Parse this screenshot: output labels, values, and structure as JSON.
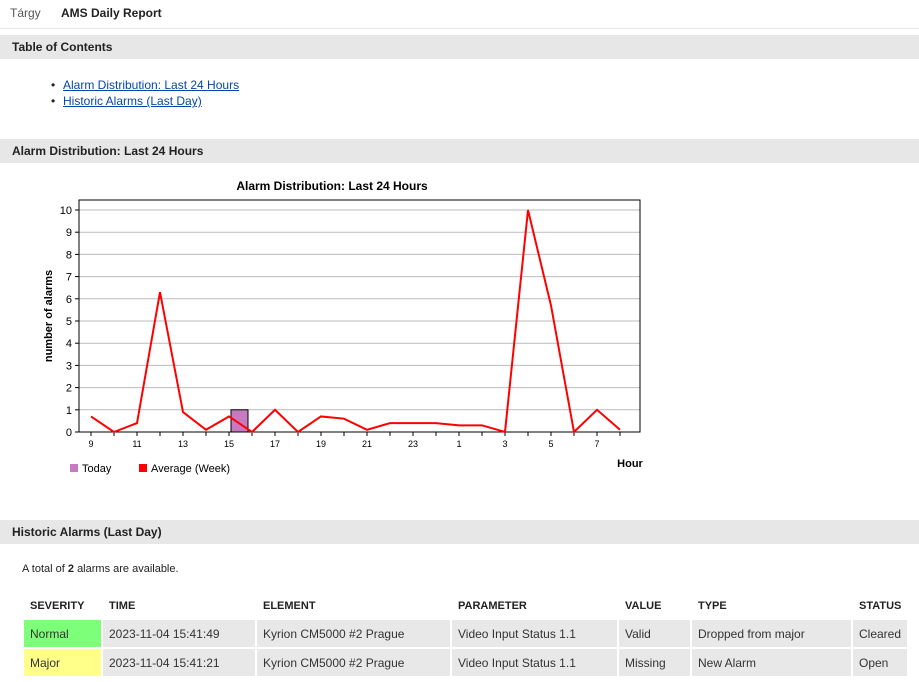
{
  "subject": {
    "label": "Tárgy",
    "value": "AMS Daily Report"
  },
  "toc": {
    "title": "Table of Contents",
    "items": [
      "Alarm Distribution: Last 24 Hours",
      "Historic Alarms (Last Day)"
    ]
  },
  "alarm_section": {
    "title": "Alarm Distribution: Last 24 Hours"
  },
  "chart_data": {
    "type": "line",
    "title": "Alarm Distribution: Last 24 Hours",
    "ylabel": "number of alarms",
    "xlabel": "Hour",
    "ylim": [
      0,
      10
    ],
    "yticks": [
      0,
      1,
      2,
      3,
      4,
      5,
      6,
      7,
      8,
      9,
      10
    ],
    "x": [
      "9",
      "10",
      "11",
      "12",
      "13",
      "14",
      "15",
      "16",
      "17",
      "18",
      "19",
      "20",
      "21",
      "22",
      "23",
      "0",
      "1",
      "2",
      "3",
      "4",
      "5",
      "6",
      "7",
      "8"
    ],
    "xtick_labels": [
      "9",
      "11",
      "13",
      "15",
      "17",
      "19",
      "21",
      "23",
      "1",
      "3",
      "5",
      "7"
    ],
    "series": [
      {
        "name": "Today",
        "type": "bar",
        "color": "#c87ac0",
        "values": [
          0,
          0,
          0,
          0,
          0,
          0,
          1,
          0,
          0,
          0,
          0,
          0,
          0,
          0,
          0,
          0,
          0,
          0,
          0,
          0,
          0,
          0,
          0,
          0
        ]
      },
      {
        "name": "Average (Week)",
        "type": "line",
        "color": "#ff0000",
        "values": [
          0.7,
          0,
          0.4,
          6.3,
          0.9,
          0.1,
          0.7,
          0,
          1.0,
          0,
          0.7,
          0.6,
          0.1,
          0.4,
          0.4,
          0.4,
          0.3,
          0.3,
          0,
          10,
          5.7,
          0,
          1.0,
          0.1
        ]
      }
    ],
    "grid": true,
    "legend": "bottom-left"
  },
  "historic": {
    "title": "Historic Alarms (Last Day)",
    "total_prefix": "A total of",
    "total_count": "2",
    "total_suffix": "alarms are available.",
    "columns": [
      "SEVERITY",
      "TIME",
      "ELEMENT",
      "PARAMETER",
      "VALUE",
      "TYPE",
      "STATUS"
    ],
    "rows": [
      {
        "severity": "Normal",
        "time": "2023-11-04 15:41:49",
        "element": "Kyrion CM5000 #2 Prague",
        "parameter": "Video Input Status 1.1",
        "value": "Valid",
        "type": "Dropped from major",
        "status": "Cleared"
      },
      {
        "severity": "Major",
        "time": "2023-11-04 15:41:21",
        "element": "Kyrion CM5000 #2 Prague",
        "parameter": "Video Input Status 1.1",
        "value": "Missing",
        "type": "New Alarm",
        "status": "Open"
      }
    ]
  },
  "colors": {
    "normal": "#7dff7a",
    "major": "#ffff8a",
    "line": "#ff0000",
    "today_bar": "#c87ac0",
    "link": "#0645ad"
  }
}
